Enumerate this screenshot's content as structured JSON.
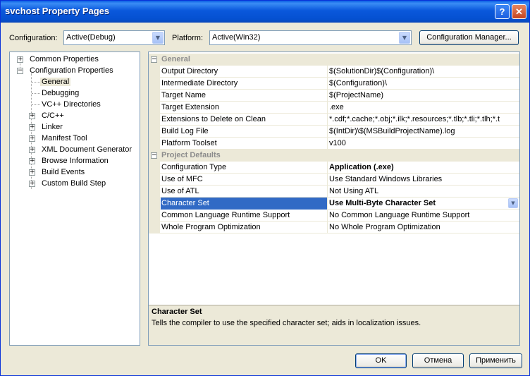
{
  "window": {
    "title": "svchost Property Pages"
  },
  "config": {
    "configuration_label": "Configuration:",
    "configuration_value": "Active(Debug)",
    "platform_label": "Platform:",
    "platform_value": "Active(Win32)",
    "manager_button": "Configuration Manager..."
  },
  "tree": {
    "common": "Common Properties",
    "configuration": "Configuration Properties",
    "children": {
      "general": "General",
      "debugging": "Debugging",
      "vc_dirs": "VC++ Directories",
      "cpp": "C/C++",
      "linker": "Linker",
      "manifest": "Manifest Tool",
      "xml": "XML Document Generator",
      "browse": "Browse Information",
      "build_events": "Build Events",
      "custom_build": "Custom Build Step"
    }
  },
  "grid": {
    "general": {
      "category": "General",
      "rows": [
        {
          "name": "Output Directory",
          "value": "$(SolutionDir)$(Configuration)\\"
        },
        {
          "name": "Intermediate Directory",
          "value": "$(Configuration)\\"
        },
        {
          "name": "Target Name",
          "value": "$(ProjectName)"
        },
        {
          "name": "Target Extension",
          "value": ".exe"
        },
        {
          "name": "Extensions to Delete on Clean",
          "value": "*.cdf;*.cache;*.obj;*.ilk;*.resources;*.tlb;*.tli;*.tlh;*.t"
        },
        {
          "name": "Build Log File",
          "value": "$(IntDir)\\$(MSBuildProjectName).log"
        },
        {
          "name": "Platform Toolset",
          "value": "v100"
        }
      ]
    },
    "defaults": {
      "category": "Project Defaults",
      "rows": [
        {
          "name": "Configuration Type",
          "value": "Application (.exe)"
        },
        {
          "name": "Use of MFC",
          "value": "Use Standard Windows Libraries"
        },
        {
          "name": "Use of ATL",
          "value": "Not Using ATL"
        },
        {
          "name": "Character Set",
          "value": "Use Multi-Byte Character Set"
        },
        {
          "name": "Common Language Runtime Support",
          "value": "No Common Language Runtime Support"
        },
        {
          "name": "Whole Program Optimization",
          "value": "No Whole Program Optimization"
        }
      ]
    }
  },
  "description": {
    "title": "Character Set",
    "text": "Tells the compiler to use the specified character set; aids in localization issues."
  },
  "buttons": {
    "ok": "OK",
    "cancel": "Отмена",
    "apply": "Применить"
  },
  "icons": {
    "help": "help-icon",
    "close": "close-icon",
    "dropdown": "chevron-down-icon",
    "expand": "expand-icon",
    "collapse": "collapse-icon"
  }
}
